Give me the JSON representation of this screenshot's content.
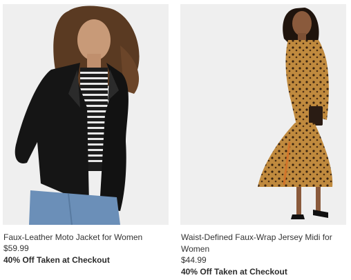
{
  "products": [
    {
      "name": "Faux-Leather Moto Jacket for Women",
      "price": "$59.99",
      "promo": "40% Off Taken at Checkout",
      "image_icon": "product-photo-leather-jacket"
    },
    {
      "name": "Waist-Defined Faux-Wrap Jersey Midi for Women",
      "price": "$44.99",
      "promo": "40% Off Taken at Checkout",
      "image_icon": "product-photo-leopard-midi-dress"
    }
  ],
  "colors": {
    "text": "#333333",
    "image_background": "#efefef"
  }
}
